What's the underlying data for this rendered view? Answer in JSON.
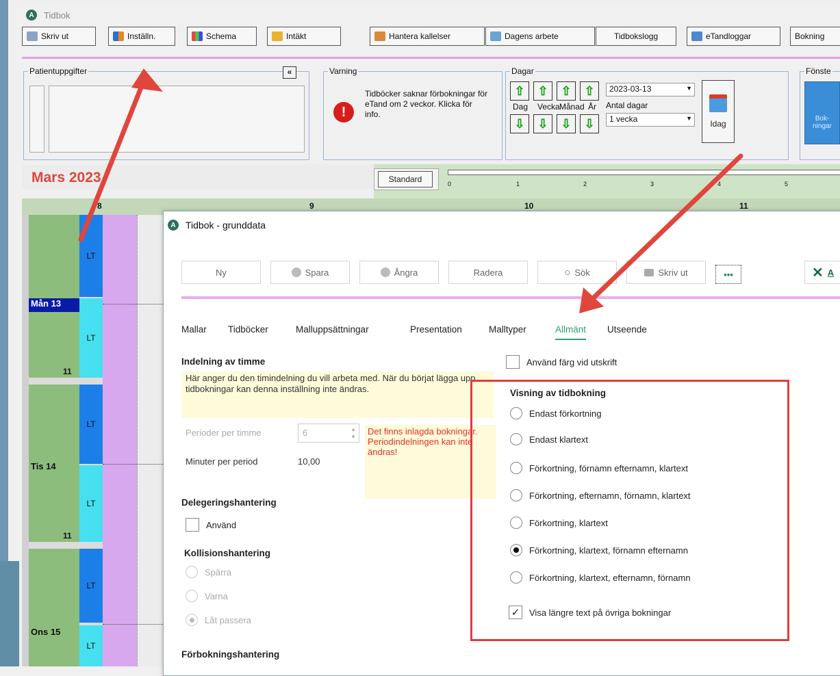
{
  "app": {
    "title": "Tidbok",
    "icon_letter": "A"
  },
  "toolbar": {
    "print": "Skriv ut",
    "settings": "Inställn.",
    "schedule": "Schema",
    "income": "Intäkt",
    "manage_calls": "Hantera kallelser",
    "daily_work": "Dagens arbete",
    "log": "Tidbokslogg",
    "etand_logs": "eTandloggar",
    "bookings": "Bokning"
  },
  "patient": {
    "title": "Patientuppgifter",
    "collapse": "«"
  },
  "warning": {
    "title": "Varning",
    "text": "Tidböcker saknar förbokningar för eTand om 2 veckor. Klicka för info."
  },
  "days": {
    "title": "Dagar",
    "labels": [
      "Dag",
      "Vecka",
      "Månad",
      "År"
    ],
    "date": "2023-03-13",
    "count_label": "Antal dagar",
    "count_value": "1 vecka",
    "today": "Idag"
  },
  "window_group": {
    "title": "Fönste",
    "btn": "Bok-\nningar"
  },
  "calendar": {
    "month": "Mars 2023",
    "mode": "Standard",
    "ruler": [
      "0",
      "1",
      "2",
      "3",
      "4",
      "5"
    ],
    "cols": [
      "8",
      "9",
      "10",
      "11"
    ],
    "days": [
      {
        "label": "Mån 13",
        "week": "11"
      },
      {
        "label": "Tis 14",
        "week": "11"
      },
      {
        "label": "Ons 15",
        "week": ""
      }
    ],
    "lt": "LT"
  },
  "dialog": {
    "title": "Tidbok - grunddata",
    "buttons": {
      "new": "Ny",
      "save": "Spara",
      "undo": "Ångra",
      "delete": "Radera",
      "search": "Sök",
      "print": "Skriv ut",
      "more": "•••",
      "close": "A"
    },
    "tabs": [
      "Mallar",
      "Tidböcker",
      "Malluppsättningar",
      "Presentation",
      "Malltyper",
      "Allmänt",
      "Utseende"
    ],
    "active_tab": "Allmänt",
    "hour_division": {
      "heading": "Indelning av timme",
      "info": "Här anger du den timindelning du vill arbeta med. När du börjat lägga upp tidbokningar kan denna inställning inte ändras.",
      "periods_label": "Perioder per timme",
      "periods_value": "6",
      "minutes_label": "Minuter per period",
      "minutes_value": "10,00",
      "warning": "Det finns inlagda bokningar. Periodindelningen kan inte ändras!"
    },
    "delegation": {
      "heading": "Delegeringshantering",
      "use": "Använd"
    },
    "collision": {
      "heading": "Kollisionshantering",
      "options": [
        "Spärra",
        "Varna",
        "Låt passera"
      ],
      "selected": "Låt passera"
    },
    "prebooking": {
      "heading": "Förbokningshantering"
    },
    "color_print": "Använd färg vid utskrift",
    "display": {
      "heading": "Visning av tidbokning",
      "options": [
        "Endast förkortning",
        "Endast klartext",
        "Förkortning, förnamn efternamn, klartext",
        "Förkortning, efternamn, förnamn, klartext",
        "Förkortning, klartext",
        "Förkortning, klartext, förnamn efternamn",
        "Förkortning, klartext, efternamn, förnamn"
      ],
      "selected": "Förkortning, klartext, förnamn efternamn",
      "longer_text": "Visa längre text på övriga bokningar"
    }
  },
  "colors": {
    "accent_pink": "#e3a3e3",
    "highlight_red": "#e03c3c",
    "calendar_green": "#8cbd7c",
    "lt_blue": "#1c7fe8",
    "lt_cyan": "#47e0f0",
    "purple": "#d7a8ee"
  }
}
